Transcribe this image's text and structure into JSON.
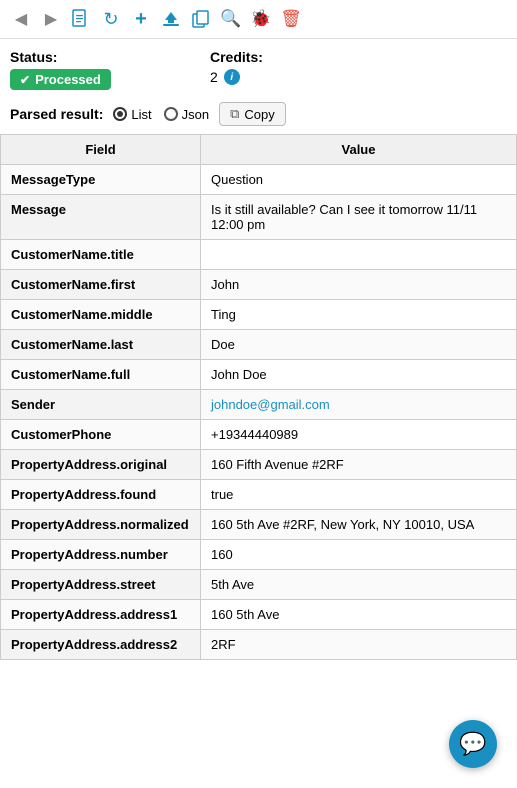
{
  "toolbar": {
    "back_icon": "◀",
    "forward_icon": "▶",
    "document_icon": "📄",
    "refresh_icon": "↻",
    "add_icon": "+",
    "upload_icon": "▲",
    "copy_icon": "⧉",
    "search_icon": "🔍",
    "bug_icon": "🐞",
    "delete_icon": "🗑"
  },
  "status": {
    "label": "Status:",
    "badge_text": "Processed",
    "check": "✔"
  },
  "credits": {
    "label": "Credits:",
    "value": "2",
    "info": "i"
  },
  "parsed_result": {
    "label": "Parsed result:",
    "options": [
      {
        "id": "list",
        "label": "List",
        "selected": true
      },
      {
        "id": "json",
        "label": "Json",
        "selected": false
      }
    ],
    "copy_label": "Copy"
  },
  "table": {
    "headers": [
      "Field",
      "Value"
    ],
    "rows": [
      {
        "field": "MessageType",
        "value": "Question",
        "is_link": false
      },
      {
        "field": "Message",
        "value": "Is it still available? Can I see it tomorrow 11/11 12:00 pm",
        "is_link": false
      },
      {
        "field": "CustomerName.title",
        "value": "",
        "is_link": false
      },
      {
        "field": "CustomerName.first",
        "value": "John",
        "is_link": false
      },
      {
        "field": "CustomerName.middle",
        "value": "Ting",
        "is_link": false
      },
      {
        "field": "CustomerName.last",
        "value": "Doe",
        "is_link": false
      },
      {
        "field": "CustomerName.full",
        "value": "John Doe",
        "is_link": false
      },
      {
        "field": "Sender",
        "value": "johndoe@gmail.com",
        "is_link": true
      },
      {
        "field": "CustomerPhone",
        "value": "+19344440989",
        "is_link": false
      },
      {
        "field": "PropertyAddress.original",
        "value": "160 Fifth Avenue #2RF",
        "is_link": false
      },
      {
        "field": "PropertyAddress.found",
        "value": "true",
        "is_link": false
      },
      {
        "field": "PropertyAddress.normalized",
        "value": "160 5th Ave #2RF, New York, NY 10010, USA",
        "is_link": false
      },
      {
        "field": "PropertyAddress.number",
        "value": "160",
        "is_link": false
      },
      {
        "field": "PropertyAddress.street",
        "value": "5th Ave",
        "is_link": false
      },
      {
        "field": "PropertyAddress.address1",
        "value": "160 5th Ave",
        "is_link": false
      },
      {
        "field": "PropertyAddress.address2",
        "value": "2RF",
        "is_link": false
      }
    ]
  },
  "chat": {
    "icon": "💬"
  }
}
